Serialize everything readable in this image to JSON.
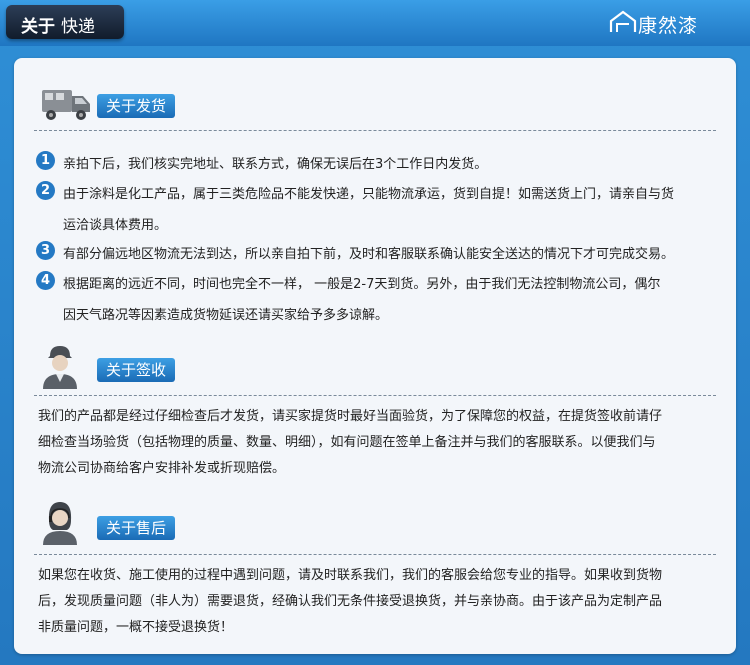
{
  "header": {
    "title_bold": "关于",
    "title_light": "快递",
    "brand_name": "康然漆",
    "brand_icon": "house-icon"
  },
  "sections": [
    {
      "heading": "关于发货",
      "icon": "delivery-truck-icon",
      "items": [
        {
          "num": "1",
          "lines": [
            "亲拍下后，我们核实完地址、联系方式，确保无误后在3个工作日内发货。"
          ]
        },
        {
          "num": "2",
          "lines": [
            "由于涂料是化工产品，属于三类危险品不能发快递，只能物流承运，货到自提！如需送货上门，请亲自与货",
            "运洽谈具体费用。"
          ]
        },
        {
          "num": "3",
          "lines": [
            "有部分偏远地区物流无法到达，所以亲自拍下前，及时和客服联系确认能安全送达的情况下才可完成交易。"
          ]
        },
        {
          "num": "4",
          "lines": [
            "根据距离的远近不同，时间也完全不一样，  一般是2-7天到货。另外，由于我们无法控制物流公司，偶尔",
            "因天气路况等因素造成货物延误还请买家给予多多谅解。"
          ]
        }
      ]
    },
    {
      "heading": "关于签收",
      "icon": "courier-person-icon",
      "lines": [
        "我们的产品都是经过仔细检查后才发货，请买家提货时最好当面验货，为了保障您的权益，在提货签收前请仔",
        "细检查当场验货（包括物理的质量、数量、明细），如有问题在签单上备注并与我们的客服联系。以便我们与",
        "物流公司协商给客户安排补发或折现赔偿。"
      ]
    },
    {
      "heading": "关于售后",
      "icon": "customer-service-icon",
      "lines": [
        "如果您在收货、施工使用的过程中遇到问题，请及时联系我们，我们的客服会给您专业的指导。如果收到货物",
        "后，发现质量问题（非人为）需要退货，经确认我们无条件接受退换货，并与亲协商。由于该产品为定制产品",
        "非质量问题，一概不接受退换货！"
      ]
    }
  ]
}
